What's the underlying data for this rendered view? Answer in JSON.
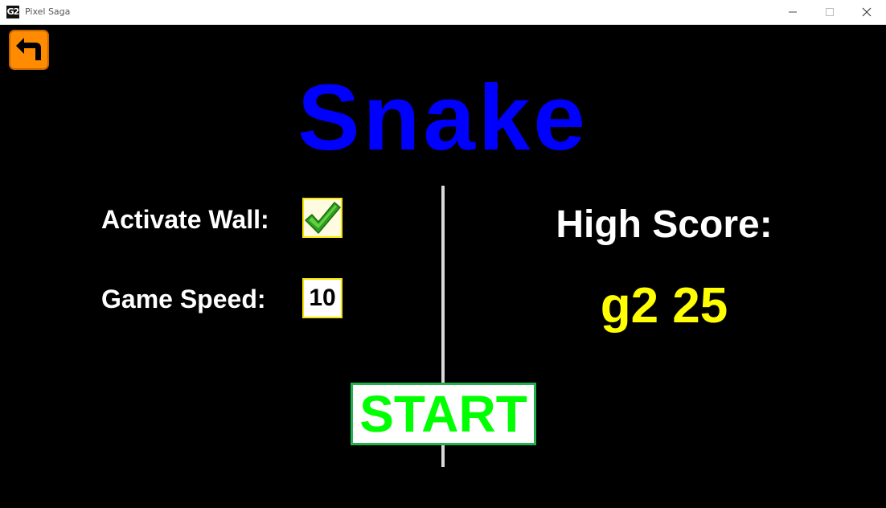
{
  "window": {
    "title": "Pixel Saga",
    "app_icon_text": "G2",
    "controls": {
      "minimize_icon": "minimize-icon",
      "maximize_icon": "maximize-icon",
      "close_icon": "close-icon"
    }
  },
  "game": {
    "title": "Snake",
    "title_color": "#0000ff",
    "back_icon": "back-arrow-icon",
    "back_color": "#ff8c00"
  },
  "settings": {
    "activate_wall_label": "Activate Wall:",
    "activate_wall_checked": true,
    "game_speed_label": "Game Speed:",
    "game_speed_value": "10"
  },
  "high_score": {
    "label": "High Score:",
    "value": "g2 25",
    "value_color": "#ffff00"
  },
  "start_button": {
    "label": "START",
    "text_color": "#00ff00"
  }
}
